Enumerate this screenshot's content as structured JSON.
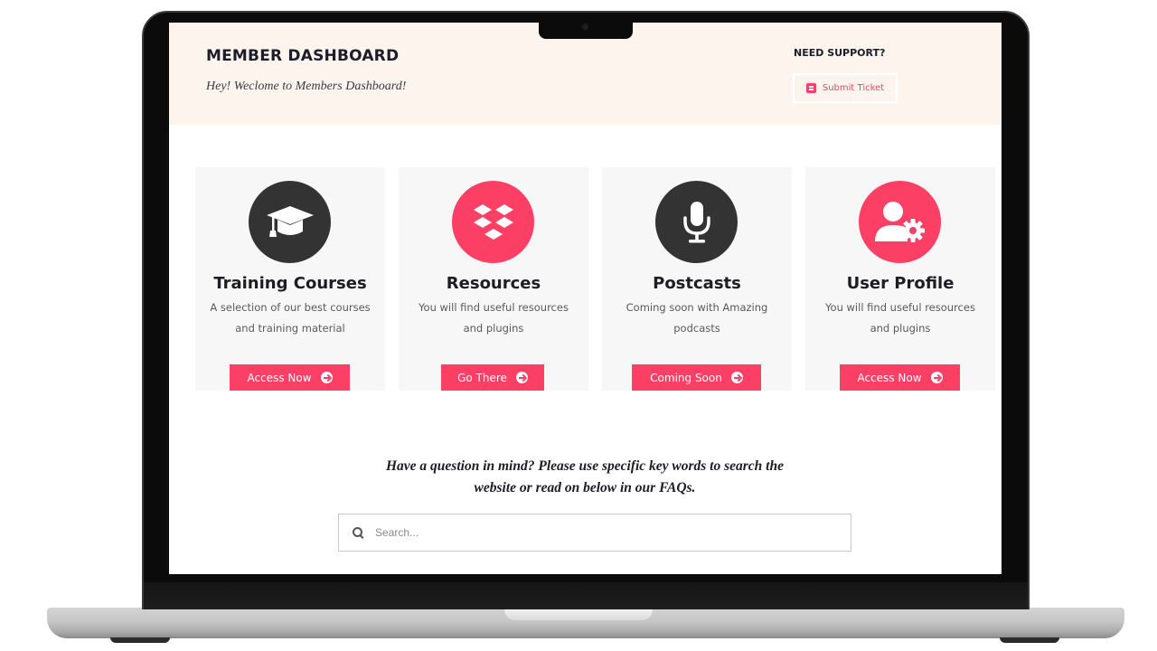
{
  "header": {
    "title": "MEMBER DASHBOARD",
    "subtitle": "Hey! Weclome to Members Dashboard!",
    "support_label": "NEED SUPPORT?",
    "ticket_button": "Submit Ticket",
    "ticket_icon": "ticket-icon"
  },
  "cards": [
    {
      "icon": "graduation-cap-icon",
      "title": "Training Courses",
      "description": "A selection of our best courses and training material",
      "button": "Access Now",
      "circle_color": "#333333"
    },
    {
      "icon": "dropbox-icon",
      "title": "Resources",
      "description": "You will find useful resources and plugins",
      "button": "Go There",
      "circle_color": "#fc3f65"
    },
    {
      "icon": "microphone-icon",
      "title": "Postcasts",
      "description": "Coming soon with Amazing podcasts",
      "button": "Coming Soon",
      "circle_color": "#333333"
    },
    {
      "icon": "user-settings-icon",
      "title": "User Profile",
      "description": "You will find useful resources and plugins",
      "button": "Access Now",
      "circle_color": "#fc3f65"
    }
  ],
  "faq": {
    "prompt": "Have a question in mind? Please use specific key words to search the website or read on below in our FAQs.",
    "search_placeholder": "Search...",
    "search_value": ""
  },
  "colors": {
    "accent": "#fc3f65",
    "dark": "#333333",
    "header_bg": "#fdf5ed",
    "card_bg": "#f7f7f7"
  }
}
